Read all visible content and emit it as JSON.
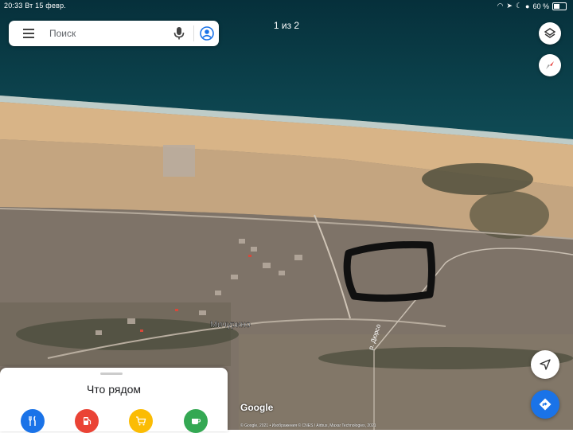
{
  "status_bar": {
    "time": "20:33",
    "date": "Вт 15 февр.",
    "battery": "60 %"
  },
  "search": {
    "placeholder": "Поиск"
  },
  "pager": {
    "label": "1 из 2"
  },
  "map": {
    "place_label": "Мичурино",
    "river_label": "р. Дюрсо"
  },
  "branding": {
    "logo": "Google",
    "attribution": "© Google, 2021 • Изображения © CNES / Airbus, Maxar Technologies, 2021"
  },
  "nearby": {
    "title": "Что рядом",
    "categories": [
      {
        "name": "restaurants-icon",
        "color": "#1a73e8"
      },
      {
        "name": "gas-station-icon",
        "color": "#ea4335"
      },
      {
        "name": "shopping-cart-icon",
        "color": "#fbbc04"
      },
      {
        "name": "cafe-icon",
        "color": "#34a853"
      }
    ]
  },
  "colors": {
    "water": "#0b3a44",
    "accent": "#1a73e8"
  }
}
